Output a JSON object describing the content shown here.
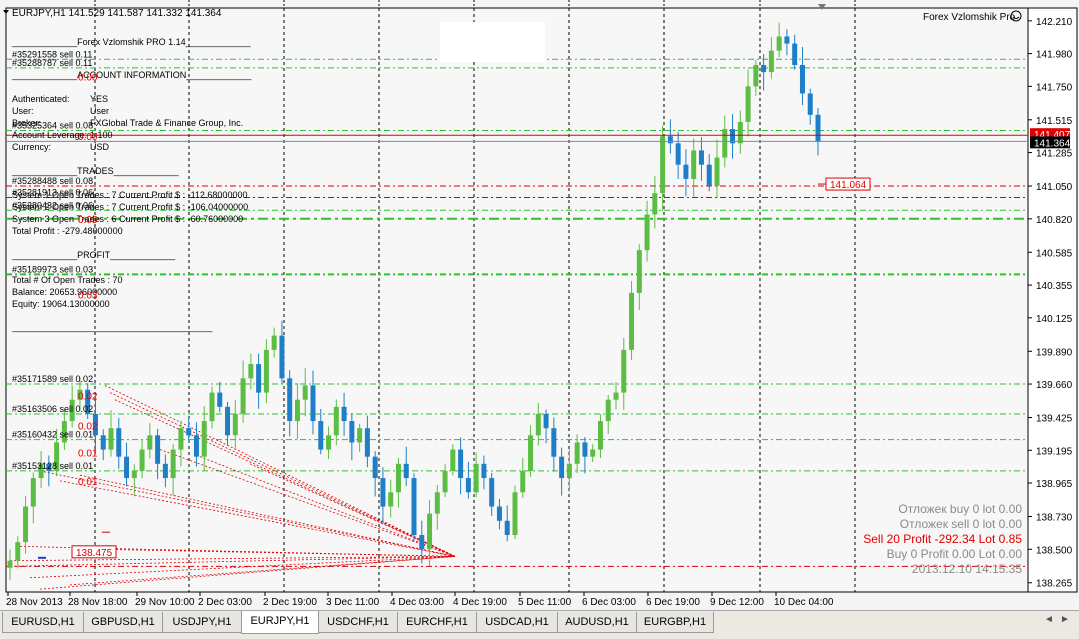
{
  "header": {
    "title_line": "EURJPY,H1  141.529 141.587 141.332 141.364",
    "ea_label": "Forex Vzlomshik Pro",
    "smile_icon": "smiley-icon"
  },
  "panel": {
    "heading": "_____________Forex Vzlomshik PRO 1.14_____________",
    "account_header": "_____________ACCOUNT INFORMATION_____________",
    "authenticated_label": "Authenticated:",
    "authenticated_value": "YES",
    "user_label": "User:",
    "user_value": "User",
    "broker_label": "Broker:",
    "broker_value": "FXGlobal Trade & Finance Group, Inc.",
    "leverage_label": "Account Leverage:",
    "leverage_value": "1:100",
    "currency_label": "Currency:",
    "currency_value": "USD",
    "trades_header": "_____________TRADES_____________",
    "system1": "System 1 Open Trades :  7    Current Profit $ :  -112.68000000",
    "system2": "System 2 Open Trades :  7    Current Profit $ :  -106.04000000",
    "system3": "System 3 Open Trades :  6    Current Profit $ :  -60.76000000",
    "total_profit": "Total Profit  :   -279.48000000",
    "profit_header": "_____________PROFIT_____________",
    "total_open": "Total # Of Open Trades :   70",
    "balance": "Balance:    20653.96000000",
    "equity": "Equity:      19064.13000000",
    "footer_rule": "________________________________________"
  },
  "info_box": {
    "line1": "Отложек buy 0    lot 0.00",
    "line2": "Отложек sell 0    lot 0.00",
    "line3": "Sell 20  Profit -292.34  Lot 0.85",
    "line4": "Buy 0  Profit 0.00  Lot 0.00",
    "line5": "2013.12.10 14:15:35"
  },
  "order_labels": [
    {
      "text": "#35291558 sell 0.11",
      "price": 141.94
    },
    {
      "text": "#35288787 sell 0.11",
      "price": 141.88
    },
    {
      "text": "#35325364 sell 0.08",
      "price": 141.44
    },
    {
      "text": "#35288488 sell 0.08",
      "price": 141.05
    },
    {
      "text": "#35281913 sell 0.06",
      "price": 140.97
    },
    {
      "text": "#35280432 sell 0.06",
      "price": 140.88
    },
    {
      "text": "#35189973 sell 0.03",
      "price": 140.43
    },
    {
      "text": "#35171589 sell 0.02",
      "price": 139.66
    },
    {
      "text": "#35163506 sell 0.02",
      "price": 139.45
    },
    {
      "text": "#35160432 sell 0.01",
      "price": 139.27
    },
    {
      "text": "#35153128 sell 0.01",
      "price": 139.05
    }
  ],
  "red_numbers": [
    {
      "text": "0.00",
      "price": 141.82
    },
    {
      "text": "0.00",
      "price": 141.4
    },
    {
      "text": "0.05",
      "price": 140.82
    },
    {
      "text": "0.03",
      "price": 140.29
    },
    {
      "text": "0.02",
      "price": 139.58
    },
    {
      "text": "0.02",
      "price": 139.37
    },
    {
      "text": "0.01",
      "price": 139.18
    },
    {
      "text": "0.01",
      "price": 138.98
    }
  ],
  "price_tags": {
    "ask": "141.407",
    "bid": "141.364",
    "level": "141.064",
    "low_level": "138.475"
  },
  "colors": {
    "bull": "#5cbd44",
    "bear": "#1e7fc8",
    "grid": "#000000",
    "green_level": "#2fbf2f",
    "red_level": "#e00000",
    "info_red": "#e00000",
    "info_grey": "#8a8a8a"
  },
  "tabs": [
    "EURUSD,H1",
    "GBPUSD,H1",
    "USDJPY,H1",
    "EURJPY,H1",
    "USDCHF,H1",
    "EURCHF,H1",
    "USDCAD,H1",
    "AUDUSD,H1",
    "EURGBP,H1"
  ],
  "active_tab": "EURJPY,H1",
  "chart_data": {
    "type": "candlestick",
    "symbol": "EURJPY",
    "timeframe": "H1",
    "ylim": [
      138.2,
      142.3
    ],
    "y_ticks": [
      142.21,
      141.98,
      141.75,
      141.515,
      141.285,
      141.05,
      140.82,
      140.585,
      140.355,
      140.125,
      139.89,
      139.66,
      139.425,
      139.195,
      138.965,
      138.73,
      138.5,
      138.265
    ],
    "x_ticks": [
      "28 Nov 2013",
      "28 Nov 18:00",
      "29 Nov 10:00",
      "2 Dec 03:00",
      "2 Dec 19:00",
      "3 Dec 11:00",
      "4 Dec 03:00",
      "4 Dec 19:00",
      "5 Dec 11:00",
      "6 Dec 03:00",
      "6 Dec 19:00",
      "9 Dec 12:00",
      "10 Dec 04:00"
    ],
    "close_path": [
      138.42,
      138.55,
      138.8,
      139.0,
      139.1,
      139.05,
      139.25,
      139.4,
      139.55,
      139.62,
      139.45,
      139.3,
      139.2,
      139.35,
      139.15,
      139.0,
      139.05,
      139.2,
      139.3,
      139.1,
      139.0,
      139.2,
      139.35,
      139.3,
      139.15,
      139.4,
      139.6,
      139.5,
      139.3,
      139.45,
      139.7,
      139.8,
      139.6,
      139.9,
      140.0,
      139.7,
      139.4,
      139.55,
      139.65,
      139.4,
      139.2,
      139.3,
      139.5,
      139.4,
      139.25,
      139.35,
      139.15,
      139.0,
      138.8,
      138.9,
      139.1,
      139.0,
      138.6,
      138.5,
      138.75,
      138.9,
      139.05,
      139.2,
      139.0,
      138.9,
      139.1,
      139.0,
      138.8,
      138.7,
      138.6,
      138.9,
      139.05,
      139.3,
      139.45,
      139.35,
      139.15,
      139.0,
      139.1,
      139.25,
      139.15,
      139.2,
      139.4,
      139.55,
      139.6,
      139.9,
      140.3,
      140.6,
      140.85,
      141.0,
      141.4,
      141.35,
      141.2,
      141.1,
      141.3,
      141.2,
      141.05,
      141.25,
      141.45,
      141.35,
      141.5,
      141.75,
      141.9,
      141.85,
      142.0,
      142.1,
      142.05,
      141.9,
      141.7,
      141.55,
      141.36
    ]
  }
}
